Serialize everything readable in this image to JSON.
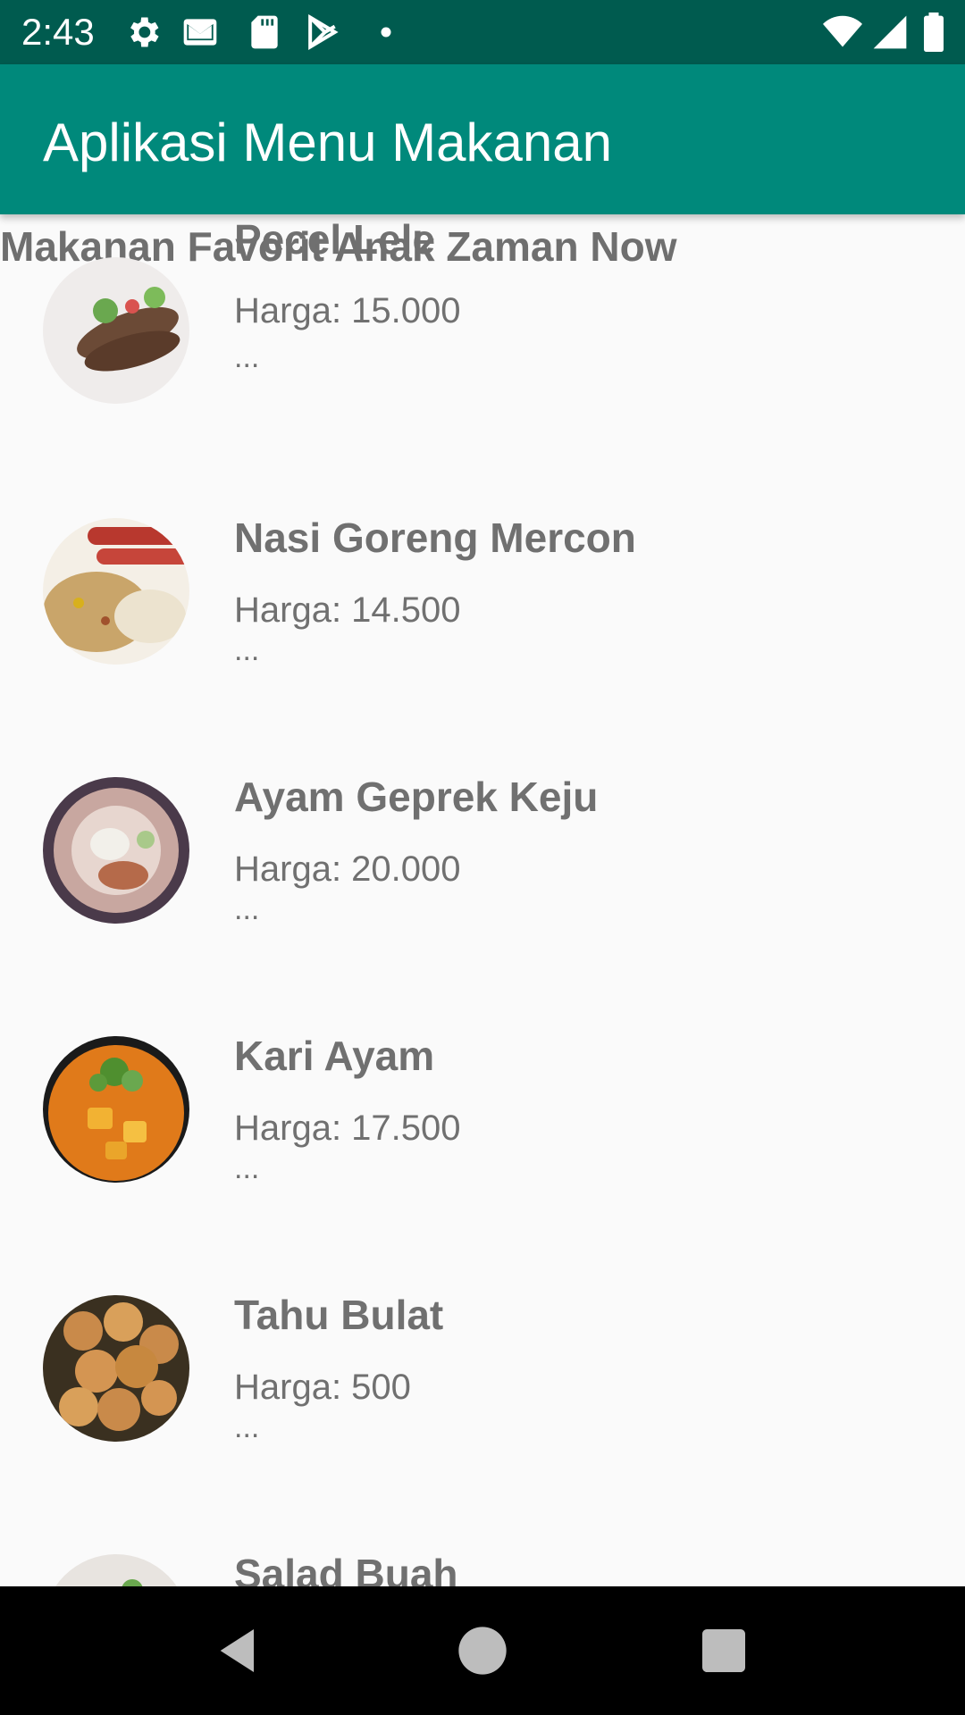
{
  "status_bar": {
    "time": "2:43",
    "icons": [
      "gear-icon",
      "gmail-icon",
      "sd-card-icon",
      "play-store-icon",
      "dot-icon",
      "wifi-icon",
      "signal-icon",
      "battery-icon"
    ]
  },
  "app_bar": {
    "title": "Aplikasi Menu Makanan"
  },
  "list": {
    "header": "Makanan Favorit Anak Zaman Now",
    "items": [
      {
        "name": "Pecel Lele",
        "price": "Harga: 15.000",
        "ellipsis": "...",
        "thumb_color": "#8a6a4a"
      },
      {
        "name": "Nasi Goreng Mercon",
        "price": "Harga: 14.500",
        "ellipsis": "...",
        "thumb_color": "#c9a56a"
      },
      {
        "name": "Ayam Geprek Keju",
        "price": "Harga: 20.000",
        "ellipsis": "...",
        "thumb_color": "#b59a8e"
      },
      {
        "name": "Kari Ayam",
        "price": "Harga: 17.500",
        "ellipsis": "...",
        "thumb_color": "#e07a1a"
      },
      {
        "name": "Tahu Bulat",
        "price": "Harga: 500",
        "ellipsis": "...",
        "thumb_color": "#c98a4a"
      },
      {
        "name": "Salad Buah",
        "price": "",
        "ellipsis": "",
        "thumb_color": "#d8d0c8"
      }
    ]
  },
  "nav_bar": {
    "icons": [
      "back-icon",
      "home-icon",
      "recents-icon"
    ]
  },
  "colors": {
    "status_bar": "#005b4f",
    "app_bar": "#00897b",
    "background": "#fafafa",
    "text": "#707070"
  }
}
